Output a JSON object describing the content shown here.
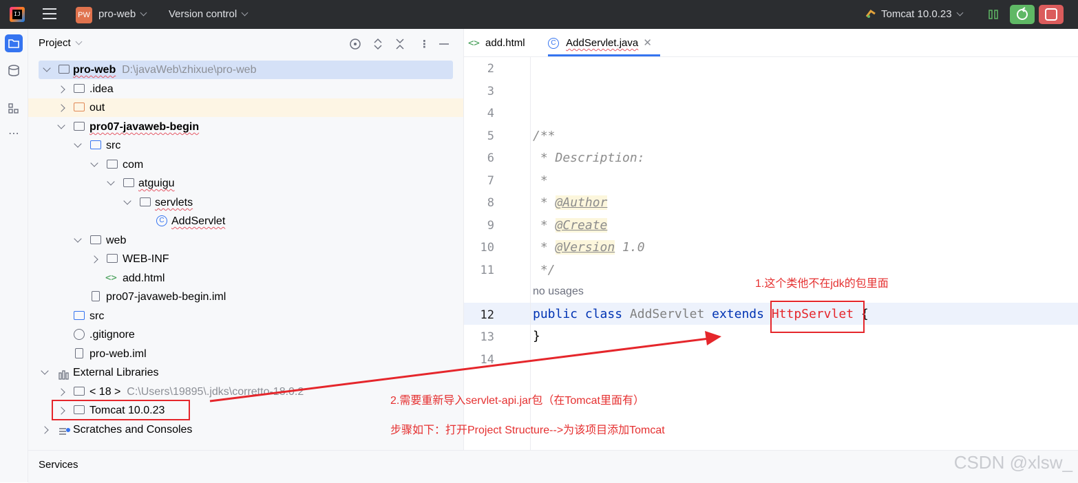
{
  "titlebar": {
    "logo_text": "IJ",
    "project_badge": "PW",
    "project_name": "pro-web",
    "vcs_label": "Version control",
    "run_config": "Tomcat 10.0.23"
  },
  "project_panel": {
    "title": "Project",
    "tree": [
      {
        "label": "pro-web",
        "path": "D:\\javaWeb\\zhixue\\pro-web"
      },
      {
        "label": ".idea"
      },
      {
        "label": "out"
      },
      {
        "label": "pro07-javaweb-begin"
      },
      {
        "label": "src"
      },
      {
        "label": "com"
      },
      {
        "label": "atguigu"
      },
      {
        "label": "servlets"
      },
      {
        "label": "AddServlet"
      },
      {
        "label": "web"
      },
      {
        "label": "WEB-INF"
      },
      {
        "label": "add.html"
      },
      {
        "label": "pro07-javaweb-begin.iml"
      },
      {
        "label": "src"
      },
      {
        "label": ".gitignore"
      },
      {
        "label": "pro-web.iml"
      },
      {
        "label": "External Libraries"
      },
      {
        "label": "< 18 >",
        "path": "C:\\Users\\19895\\.jdks\\corretto-18.0.2"
      },
      {
        "label": "Tomcat 10.0.23"
      },
      {
        "label": "Scratches and Consoles"
      }
    ]
  },
  "editor": {
    "tabs": [
      {
        "label": "add.html"
      },
      {
        "label": "AddServlet.java"
      }
    ],
    "line_numbers": [
      "2",
      "3",
      "4",
      "5",
      "6",
      "7",
      "8",
      "9",
      "10",
      "11",
      "12",
      "13",
      "14"
    ],
    "code": {
      "l5": "/**",
      "l6": " * Description:",
      "l7": " *",
      "l8_prefix": " * ",
      "l8_tag": "@Author",
      "l9_prefix": " * ",
      "l9_tag": "@Create",
      "l10_prefix": " * ",
      "l10_tag": "@Version",
      "l10_rest": " 1.0",
      "l11": " */",
      "usages": "no usages",
      "l12_kw1": "public",
      "l12_kw2": "class",
      "l12_name": "AddServlet",
      "l12_kw3": "extends",
      "l12_super": "HttpServlet",
      "l12_brace": "{",
      "l13": "}"
    }
  },
  "annotations": {
    "note1": "1.这个类他不在jdk的包里面",
    "note2": "2.需要重新导入servlet-api.jar包（在Tomcat里面有）",
    "note3": "步骤如下：打开Project Structure-->为该项目添加Tomcat"
  },
  "services": {
    "label": "Services"
  },
  "watermark": "CSDN @xlsw_"
}
